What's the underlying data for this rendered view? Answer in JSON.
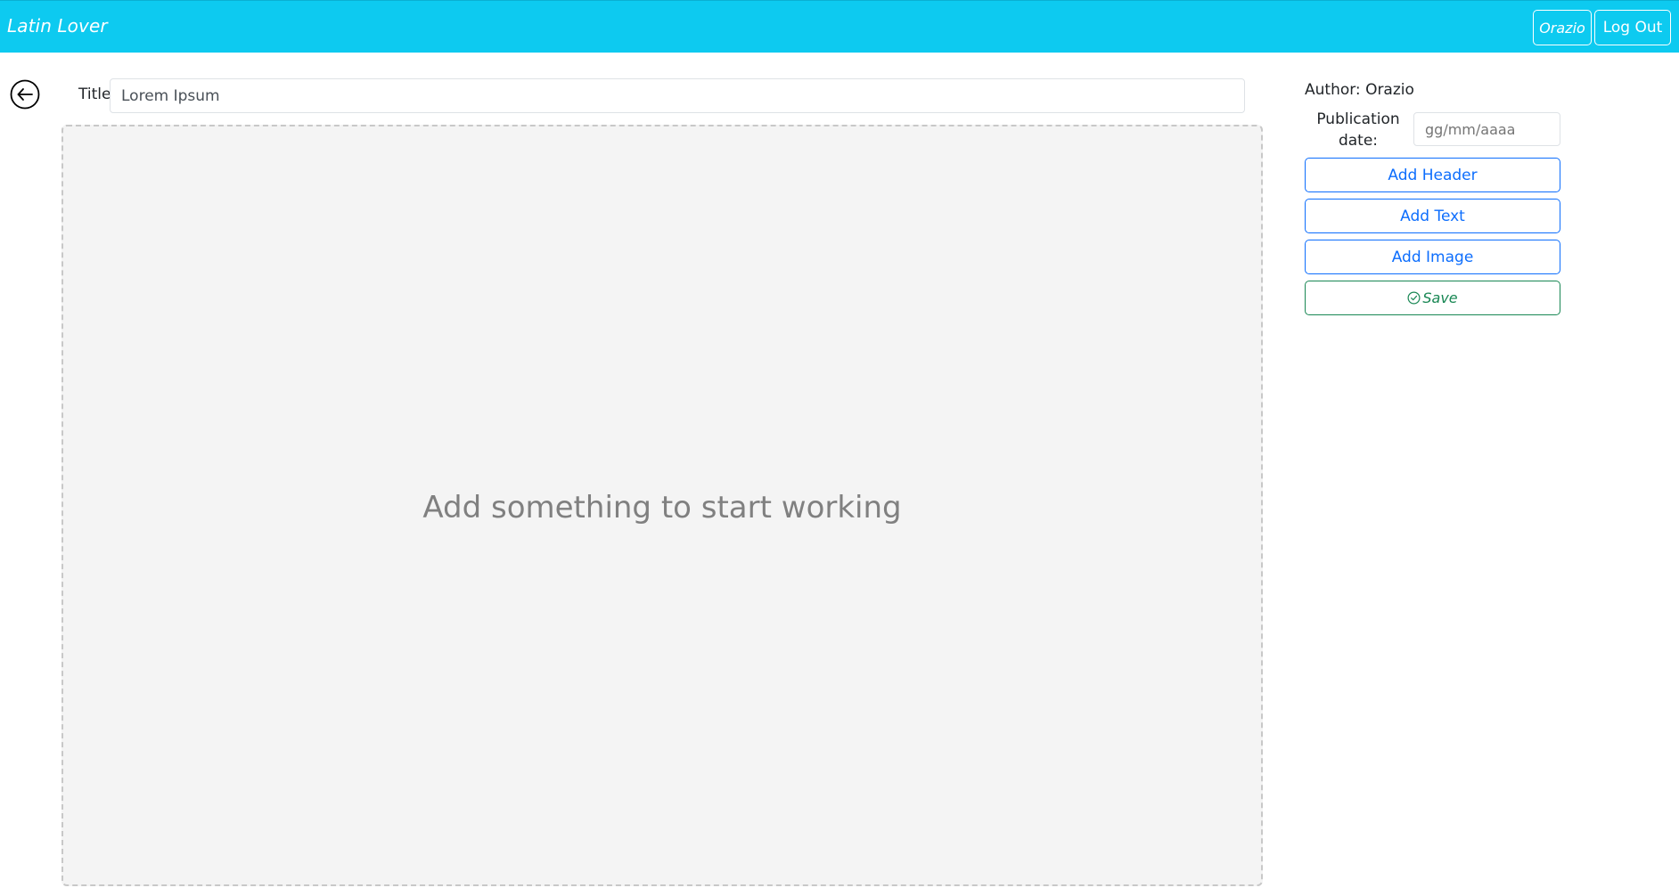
{
  "navbar": {
    "brand": "Latin Lover",
    "user_button": "Orazio",
    "logout_button": "Log Out",
    "background_color": "#0dcaf0"
  },
  "editor": {
    "title_label": "Title:",
    "title_value": "Lorem Ipsum",
    "empty_message": "Add something to start working",
    "back_icon": "arrow-left-circle-icon"
  },
  "side_panel": {
    "author": "Author: Orazio",
    "publication_date_label": "Publication date:",
    "publication_date_placeholder": "gg/mm/aaaa",
    "add_header_label": "Add Header",
    "add_text_label": "Add Text",
    "add_image_label": "Add Image",
    "save_label": "Save",
    "save_icon": "check-circle-icon",
    "primary_color": "#0d6efd",
    "success_color": "#198754"
  }
}
